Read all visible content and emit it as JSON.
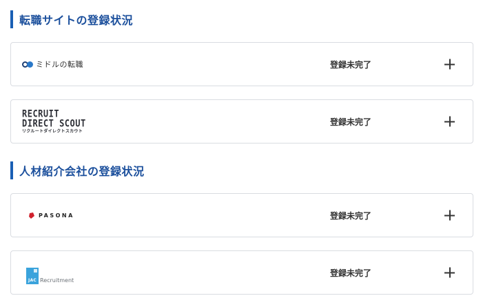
{
  "job_sites": {
    "heading": "転職サイトの登録状況",
    "items": [
      {
        "logo_text": "ミドルの転職",
        "status": "登録未完了"
      },
      {
        "logo_line1": "RECRUIT",
        "logo_line2": "DIRECT SCOUT",
        "logo_line3": "リクルートダイレクトスカウト",
        "status": "登録未完了"
      }
    ]
  },
  "agencies": {
    "heading": "人材紹介会社の登録状況",
    "items": [
      {
        "logo_text": "PASONA",
        "status": "登録未完了"
      },
      {
        "logo_mark_text": "JAC",
        "logo_text": "Recruitment",
        "status": "登録未完了"
      }
    ]
  },
  "colors": {
    "heading_accent": "#1a5fb4",
    "heading_text": "#1b4f9c",
    "card_border": "#d9dce1",
    "pasona_red": "#d0212d",
    "jac_blue": "#3aa3dc"
  },
  "icons": {
    "expand": "plus-icon"
  }
}
